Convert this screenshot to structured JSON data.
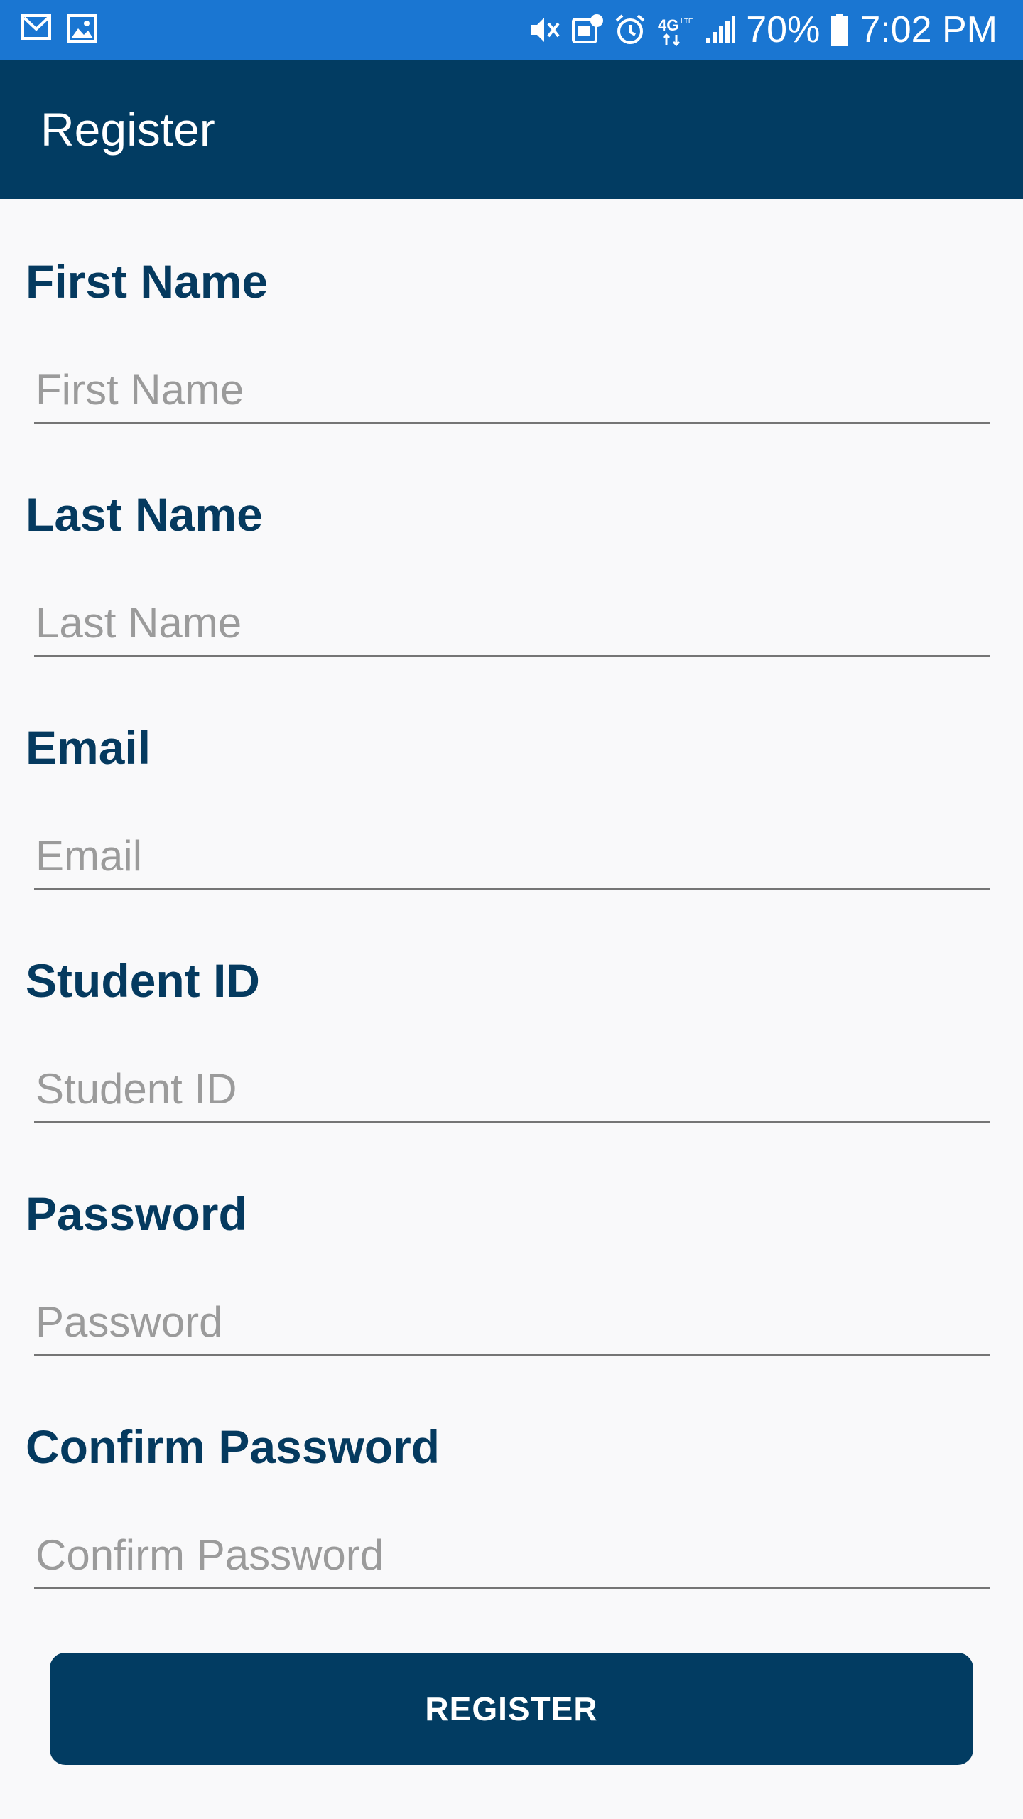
{
  "status_bar": {
    "icons_left": [
      "gmail-icon",
      "gallery-icon"
    ],
    "icons_right": [
      "mute-icon",
      "screen-mirror-icon",
      "alarm-icon",
      "4g-lte-icon",
      "signal-icon",
      "battery-icon"
    ],
    "battery": "70%",
    "time": "7:02 PM"
  },
  "app_bar": {
    "title": "Register"
  },
  "form": {
    "fields": [
      {
        "label": "First Name",
        "placeholder": "First Name"
      },
      {
        "label": "Last Name",
        "placeholder": "Last Name"
      },
      {
        "label": "Email",
        "placeholder": "Email"
      },
      {
        "label": "Student ID",
        "placeholder": "Student ID"
      },
      {
        "label": "Password",
        "placeholder": "Password"
      },
      {
        "label": "Confirm Password",
        "placeholder": "Confirm Password"
      }
    ],
    "submit_label": "REGISTER"
  },
  "colors": {
    "status_bar": "#1a76d2",
    "app_bar": "#023c62",
    "label_text": "#053a5f",
    "button": "#023c62",
    "background": "#f9f9fa"
  }
}
